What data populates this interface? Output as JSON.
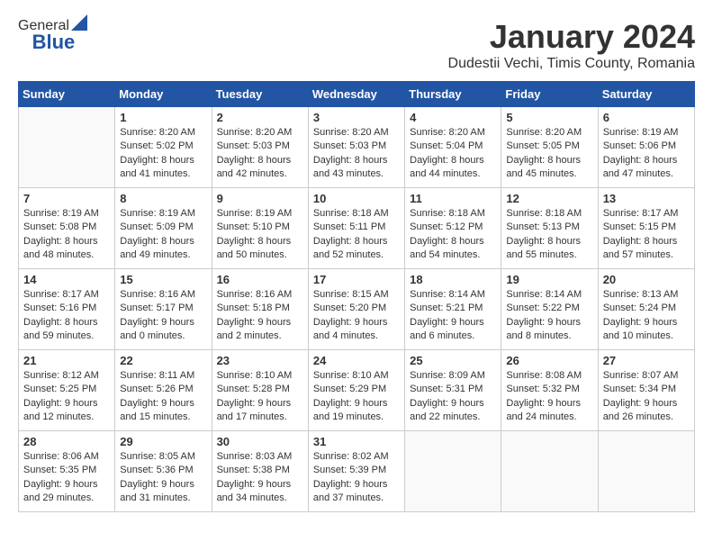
{
  "header": {
    "logo_general": "General",
    "logo_blue": "Blue",
    "month_title": "January 2024",
    "location": "Dudestii Vechi, Timis County, Romania"
  },
  "calendar": {
    "days_of_week": [
      "Sunday",
      "Monday",
      "Tuesday",
      "Wednesday",
      "Thursday",
      "Friday",
      "Saturday"
    ],
    "weeks": [
      [
        {
          "day": "",
          "info": ""
        },
        {
          "day": "1",
          "info": "Sunrise: 8:20 AM\nSunset: 5:02 PM\nDaylight: 8 hours\nand 41 minutes."
        },
        {
          "day": "2",
          "info": "Sunrise: 8:20 AM\nSunset: 5:03 PM\nDaylight: 8 hours\nand 42 minutes."
        },
        {
          "day": "3",
          "info": "Sunrise: 8:20 AM\nSunset: 5:03 PM\nDaylight: 8 hours\nand 43 minutes."
        },
        {
          "day": "4",
          "info": "Sunrise: 8:20 AM\nSunset: 5:04 PM\nDaylight: 8 hours\nand 44 minutes."
        },
        {
          "day": "5",
          "info": "Sunrise: 8:20 AM\nSunset: 5:05 PM\nDaylight: 8 hours\nand 45 minutes."
        },
        {
          "day": "6",
          "info": "Sunrise: 8:19 AM\nSunset: 5:06 PM\nDaylight: 8 hours\nand 47 minutes."
        }
      ],
      [
        {
          "day": "7",
          "info": "Sunrise: 8:19 AM\nSunset: 5:08 PM\nDaylight: 8 hours\nand 48 minutes."
        },
        {
          "day": "8",
          "info": "Sunrise: 8:19 AM\nSunset: 5:09 PM\nDaylight: 8 hours\nand 49 minutes."
        },
        {
          "day": "9",
          "info": "Sunrise: 8:19 AM\nSunset: 5:10 PM\nDaylight: 8 hours\nand 50 minutes."
        },
        {
          "day": "10",
          "info": "Sunrise: 8:18 AM\nSunset: 5:11 PM\nDaylight: 8 hours\nand 52 minutes."
        },
        {
          "day": "11",
          "info": "Sunrise: 8:18 AM\nSunset: 5:12 PM\nDaylight: 8 hours\nand 54 minutes."
        },
        {
          "day": "12",
          "info": "Sunrise: 8:18 AM\nSunset: 5:13 PM\nDaylight: 8 hours\nand 55 minutes."
        },
        {
          "day": "13",
          "info": "Sunrise: 8:17 AM\nSunset: 5:15 PM\nDaylight: 8 hours\nand 57 minutes."
        }
      ],
      [
        {
          "day": "14",
          "info": "Sunrise: 8:17 AM\nSunset: 5:16 PM\nDaylight: 8 hours\nand 59 minutes."
        },
        {
          "day": "15",
          "info": "Sunrise: 8:16 AM\nSunset: 5:17 PM\nDaylight: 9 hours\nand 0 minutes."
        },
        {
          "day": "16",
          "info": "Sunrise: 8:16 AM\nSunset: 5:18 PM\nDaylight: 9 hours\nand 2 minutes."
        },
        {
          "day": "17",
          "info": "Sunrise: 8:15 AM\nSunset: 5:20 PM\nDaylight: 9 hours\nand 4 minutes."
        },
        {
          "day": "18",
          "info": "Sunrise: 8:14 AM\nSunset: 5:21 PM\nDaylight: 9 hours\nand 6 minutes."
        },
        {
          "day": "19",
          "info": "Sunrise: 8:14 AM\nSunset: 5:22 PM\nDaylight: 9 hours\nand 8 minutes."
        },
        {
          "day": "20",
          "info": "Sunrise: 8:13 AM\nSunset: 5:24 PM\nDaylight: 9 hours\nand 10 minutes."
        }
      ],
      [
        {
          "day": "21",
          "info": "Sunrise: 8:12 AM\nSunset: 5:25 PM\nDaylight: 9 hours\nand 12 minutes."
        },
        {
          "day": "22",
          "info": "Sunrise: 8:11 AM\nSunset: 5:26 PM\nDaylight: 9 hours\nand 15 minutes."
        },
        {
          "day": "23",
          "info": "Sunrise: 8:10 AM\nSunset: 5:28 PM\nDaylight: 9 hours\nand 17 minutes."
        },
        {
          "day": "24",
          "info": "Sunrise: 8:10 AM\nSunset: 5:29 PM\nDaylight: 9 hours\nand 19 minutes."
        },
        {
          "day": "25",
          "info": "Sunrise: 8:09 AM\nSunset: 5:31 PM\nDaylight: 9 hours\nand 22 minutes."
        },
        {
          "day": "26",
          "info": "Sunrise: 8:08 AM\nSunset: 5:32 PM\nDaylight: 9 hours\nand 24 minutes."
        },
        {
          "day": "27",
          "info": "Sunrise: 8:07 AM\nSunset: 5:34 PM\nDaylight: 9 hours\nand 26 minutes."
        }
      ],
      [
        {
          "day": "28",
          "info": "Sunrise: 8:06 AM\nSunset: 5:35 PM\nDaylight: 9 hours\nand 29 minutes."
        },
        {
          "day": "29",
          "info": "Sunrise: 8:05 AM\nSunset: 5:36 PM\nDaylight: 9 hours\nand 31 minutes."
        },
        {
          "day": "30",
          "info": "Sunrise: 8:03 AM\nSunset: 5:38 PM\nDaylight: 9 hours\nand 34 minutes."
        },
        {
          "day": "31",
          "info": "Sunrise: 8:02 AM\nSunset: 5:39 PM\nDaylight: 9 hours\nand 37 minutes."
        },
        {
          "day": "",
          "info": ""
        },
        {
          "day": "",
          "info": ""
        },
        {
          "day": "",
          "info": ""
        }
      ]
    ]
  }
}
